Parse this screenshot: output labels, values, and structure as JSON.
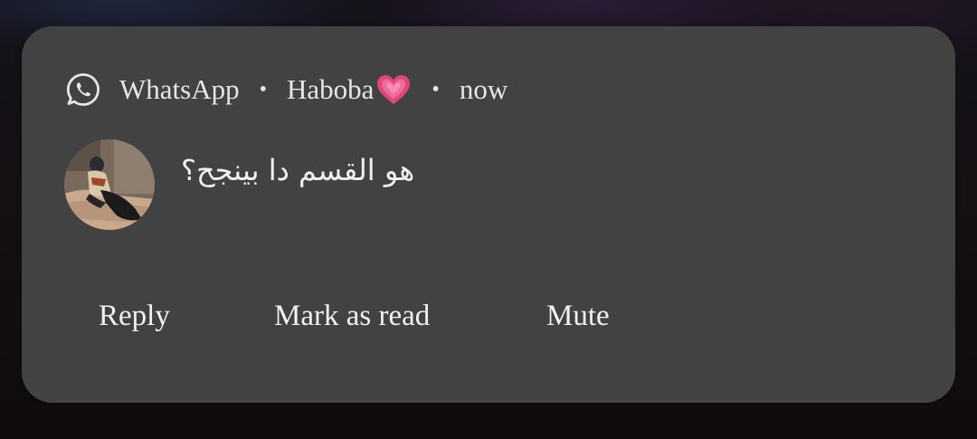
{
  "notification": {
    "app_name": "WhatsApp",
    "app_icon": "whatsapp-icon",
    "separator": "•",
    "sender": "Haboba",
    "sender_emoji": "heart-emoji",
    "time": "now",
    "message": "هو القسم دا بينجح؟",
    "avatar": "contact-photo",
    "actions": {
      "reply": "Reply",
      "mark_as_read": "Mark as read",
      "mute": "Mute"
    }
  },
  "colors": {
    "card_background": "#424242",
    "text": "#e6e6e6",
    "heart": "#e0457b"
  }
}
